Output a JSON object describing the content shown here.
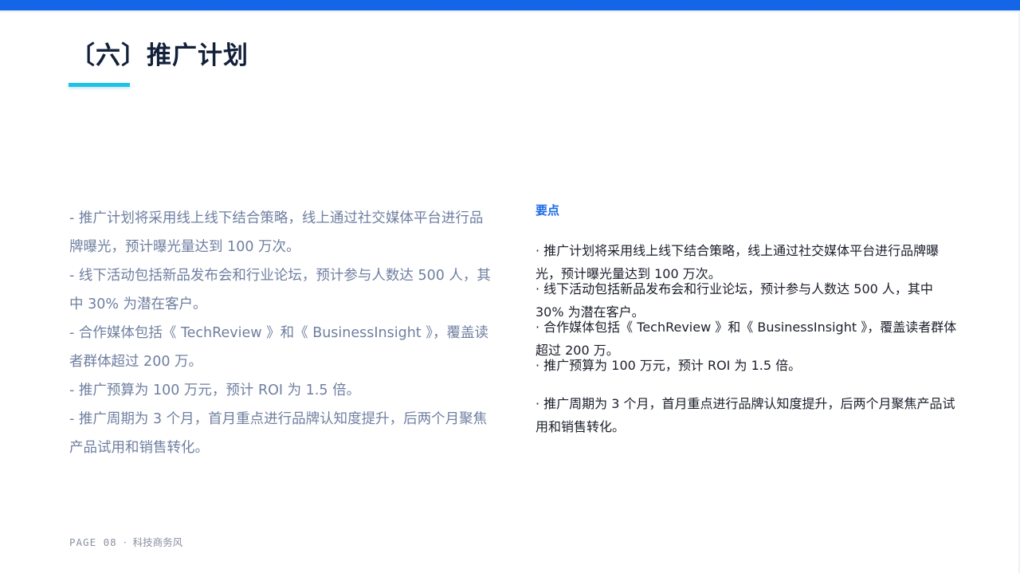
{
  "slide": {
    "title": "〔六〕推广计划",
    "left_items": [
      "- 推广计划将采用线上线下结合策略，线上通过社交媒体平台进行品牌曝光，预计曝光量达到 100 万次。",
      "- 线下活动包括新品发布会和行业论坛，预计参与人数达 500 人，其中 30% 为潜在客户。",
      "- 合作媒体包括《 TechReview 》和《 BusinessInsight 》，覆盖读者群体超过 200 万。",
      "- 推广预算为 100 万元，预计 ROI 为 1.5 倍。",
      "- 推广周期为 3 个月，首月重点进行品牌认知度提升，后两个月聚焦产品试用和销售转化。"
    ],
    "right_heading": "要点",
    "right_items": [
      "· 推广计划将采用线上线下结合策略，线上通过社交媒体平台进行品牌曝光，预计曝光量达到 100 万次。",
      "· 线下活动包括新品发布会和行业论坛，预计参与人数达 500 人，其中 30% 为潜在客户。",
      "· 合作媒体包括《 TechReview 》和《 BusinessInsight 》，覆盖读者群体超过 200 万。",
      "· 推广预算为 100 万元，预计 ROI 为 1.5 倍。",
      "· 推广周期为 3 个月，首月重点进行品牌认知度提升，后两个月聚焦产品试用和销售转化。"
    ],
    "footer": {
      "page": "PAGE 08",
      "separator": "·",
      "theme": "科技商务风"
    }
  },
  "colors": {
    "accent_bar": "#1565e9",
    "title_underline": "#1ec2e8",
    "heading_blue": "#1a6ae6"
  }
}
